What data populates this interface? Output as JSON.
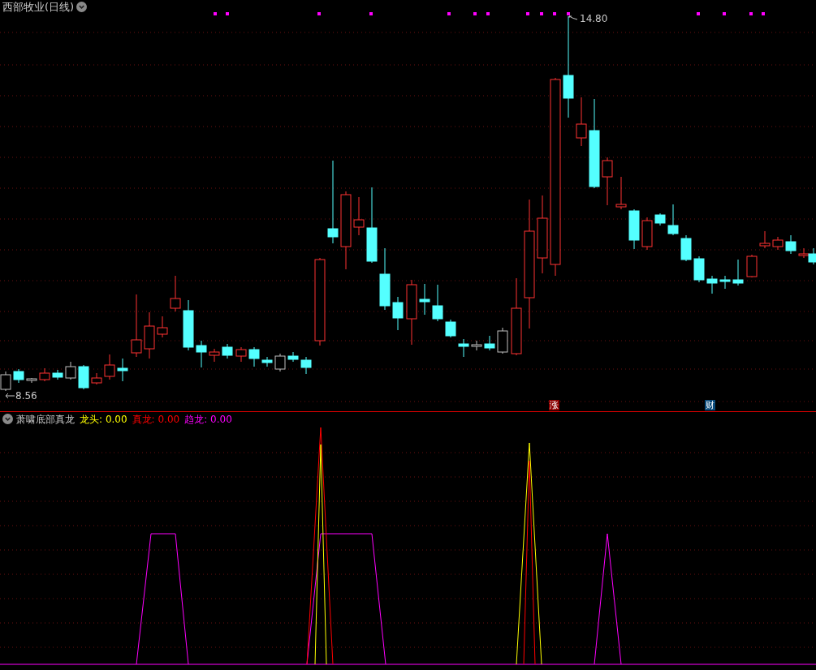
{
  "chart": {
    "title": "西部牧业(日线)",
    "high_label": "14.80",
    "low_label": "8.56"
  },
  "signals": [
    {
      "label": "涨",
      "color": "#8b0000"
    },
    {
      "label": "财",
      "color": "#0a4a7a"
    }
  ],
  "indicator": {
    "name": "萧啸底部真龙",
    "legend": [
      {
        "label": "龙头:",
        "value": "0.00",
        "color": "#ffff00"
      },
      {
        "label": "真龙:",
        "value": "0.00",
        "color": "#ff0000"
      },
      {
        "label": "趋龙:",
        "value": "0.00",
        "color": "#ff00ff"
      }
    ]
  }
}
